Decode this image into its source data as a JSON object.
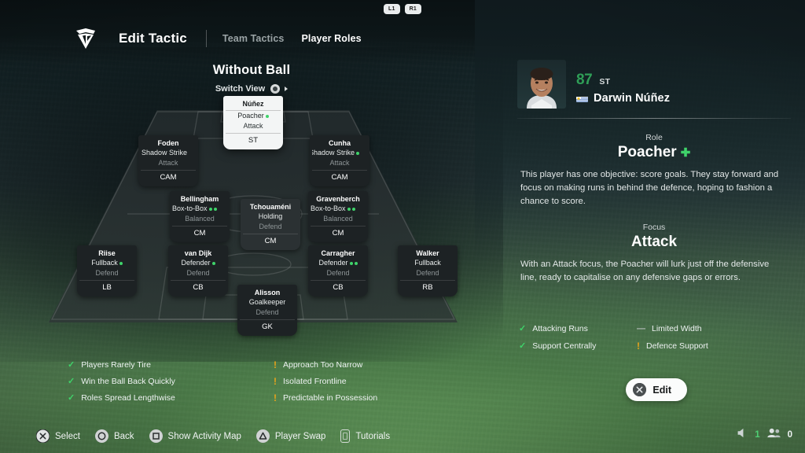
{
  "bumpers": [
    {
      "label": "L1"
    },
    {
      "label": "R1"
    }
  ],
  "header": {
    "crest_icon": "team-crest-icon",
    "title": "Edit Tactic",
    "tabs": [
      {
        "label": "Team Tactics",
        "active": false
      },
      {
        "label": "Player Roles",
        "active": true
      }
    ]
  },
  "pitch": {
    "view_title": "Without Ball",
    "switch_view_label": "Switch View",
    "switch_view_icon": "right-stick-icon",
    "players": [
      {
        "name": "Núñez",
        "role": "Poacher",
        "focus": "Attack",
        "position": "ST",
        "pips": 1,
        "selected": true
      },
      {
        "name": "Foden",
        "role": "Shadow Strike",
        "focus": "Attack",
        "position": "CAM",
        "pips": 0,
        "selected": false
      },
      {
        "name": "Cunha",
        "role": "Shadow Strike",
        "focus": "Attack",
        "position": "CAM",
        "pips": 1,
        "selected": false
      },
      {
        "name": "Bellingham",
        "role": "Box-to-Box",
        "focus": "Balanced",
        "position": "CM",
        "pips": 2,
        "selected": false
      },
      {
        "name": "Tchouaméni",
        "role": "Holding",
        "focus": "Defend",
        "position": "CM",
        "pips": 0,
        "selected": false
      },
      {
        "name": "Gravenberch",
        "role": "Box-to-Box",
        "focus": "Balanced",
        "position": "CM",
        "pips": 2,
        "selected": false
      },
      {
        "name": "Riise",
        "role": "Fullback",
        "focus": "Defend",
        "position": "LB",
        "pips": 1,
        "selected": false
      },
      {
        "name": "van Dijk",
        "role": "Defender",
        "focus": "Defend",
        "position": "CB",
        "pips": 1,
        "selected": false
      },
      {
        "name": "Carragher",
        "role": "Defender",
        "focus": "Defend",
        "position": "CB",
        "pips": 2,
        "selected": false
      },
      {
        "name": "Walker",
        "role": "Fullback",
        "focus": "Defend",
        "position": "RB",
        "pips": 0,
        "selected": false
      },
      {
        "name": "Alisson",
        "role": "Goalkeeper",
        "focus": "Defend",
        "position": "GK",
        "pips": 0,
        "selected": false
      }
    ]
  },
  "player": {
    "rating": "87",
    "position": "ST",
    "name": "Darwin Núñez",
    "nationality_flag": "uruguay-flag-icon",
    "portrait": "player-portrait",
    "role_label": "Role",
    "role_value": "Poacher",
    "role_plus": "✚",
    "role_desc": "This player has one objective: score goals. They stay forward and focus on making runs in behind the defence, hoping to fashion a chance to score.",
    "focus_label": "Focus",
    "focus_value": "Attack",
    "focus_desc": "With an Attack focus, the Poacher will lurk just off the defensive line, ready to capitalise on any defensive gaps or errors."
  },
  "player_traits": [
    {
      "text": "Attacking Runs",
      "type": "tick",
      "glyph": "✓"
    },
    {
      "text": "Limited Width",
      "type": "dash",
      "glyph": "—"
    },
    {
      "text": "Support Centrally",
      "type": "tick",
      "glyph": "✓"
    },
    {
      "text": "Defence Support",
      "type": "warn",
      "glyph": "!"
    }
  ],
  "team_traits": [
    {
      "text": "Players Rarely Tire",
      "type": "tick",
      "glyph": "✓"
    },
    {
      "text": "Approach Too Narrow",
      "type": "warn",
      "glyph": "!"
    },
    {
      "text": "Win the Ball Back Quickly",
      "type": "tick",
      "glyph": "✓"
    },
    {
      "text": "Isolated Frontline",
      "type": "warn",
      "glyph": "!"
    },
    {
      "text": "Roles Spread Lengthwise",
      "type": "tick",
      "glyph": "✓"
    },
    {
      "text": "Predictable in Possession",
      "type": "warn",
      "glyph": "!"
    }
  ],
  "edit_button": {
    "label": "Edit",
    "icon": "ps-cross-icon"
  },
  "footer": [
    {
      "label": "Select",
      "icon": "ps-cross-icon"
    },
    {
      "label": "Back",
      "icon": "ps-circle-icon"
    },
    {
      "label": "Show Activity Map",
      "icon": "ps-square-icon"
    },
    {
      "label": "Player Swap",
      "icon": "ps-triangle-icon"
    },
    {
      "label": "Tutorials",
      "icon": "ps-touchpad-icon"
    }
  ],
  "corner_status": [
    {
      "icon": "volume-icon",
      "value": "1",
      "color": "#4fcf74"
    },
    {
      "icon": "players-icon",
      "value": "0",
      "color": "#eef2f2"
    }
  ],
  "colors": {
    "accent_green": "#3fd36a",
    "rating_green": "#2f9e57",
    "warn_amber": "#e8a31b",
    "card_bg": "#1d2224",
    "selected_card_bg": "#f3f5f5"
  }
}
